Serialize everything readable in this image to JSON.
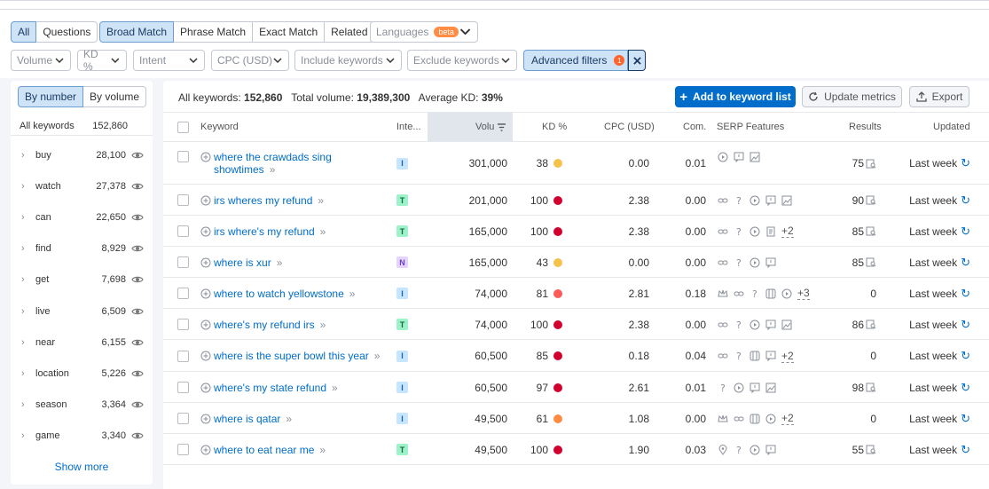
{
  "filters": {
    "tabs": [
      "All",
      "Questions"
    ],
    "match_types": [
      "Broad Match",
      "Phrase Match",
      "Exact Match",
      "Related"
    ],
    "languages": {
      "label": "Languages",
      "badge": "beta"
    },
    "dropdowns": [
      "Volume",
      "KD %",
      "Intent",
      "CPC (USD)",
      "Include keywords",
      "Exclude keywords"
    ],
    "advanced": {
      "label": "Advanced filters",
      "count": "1"
    }
  },
  "sidebar": {
    "toggle": [
      "By number",
      "By volume"
    ],
    "header": {
      "label": "All keywords",
      "count": "152,860"
    },
    "items": [
      {
        "word": "buy",
        "count": "28,100"
      },
      {
        "word": "watch",
        "count": "27,378"
      },
      {
        "word": "can",
        "count": "22,650"
      },
      {
        "word": "find",
        "count": "8,929"
      },
      {
        "word": "get",
        "count": "7,698"
      },
      {
        "word": "live",
        "count": "6,509"
      },
      {
        "word": "near",
        "count": "6,155"
      },
      {
        "word": "location",
        "count": "5,226"
      },
      {
        "word": "season",
        "count": "3,364"
      },
      {
        "word": "game",
        "count": "3,340"
      }
    ],
    "show_more": "Show more"
  },
  "summary": {
    "all_label": "All keywords:",
    "all_value": "152,860",
    "vol_label": "Total volume:",
    "vol_value": "19,389,300",
    "kd_label": "Average KD:",
    "kd_value": "39%"
  },
  "toolbar": {
    "add": "Add to keyword list",
    "update": "Update metrics",
    "export": "Export"
  },
  "columns": {
    "keyword": "Keyword",
    "intent": "Inte...",
    "volume": "Volu",
    "kd": "KD %",
    "cpc": "CPC (USD)",
    "com": "Com.",
    "serp": "SERP Features",
    "results": "Results",
    "updated": "Updated"
  },
  "colors": {
    "easy": "#f5c24a",
    "hard": "#d1002f",
    "mid": "#ff5a5a",
    "medium": "#ff8c42"
  },
  "rows": [
    {
      "kw1": "where the crawdads sing",
      "kw2": "showtimes",
      "intent": "I",
      "volume": "301,000",
      "kd": "38",
      "kd_color": "#f5c24a",
      "cpc": "0.00",
      "com": "0.01",
      "serp": [
        "play",
        "review",
        "image"
      ],
      "more": "",
      "results": "75",
      "updated": "Last week"
    },
    {
      "kw1": "irs wheres my refund",
      "kw2": "",
      "intent": "T",
      "volume": "201,000",
      "kd": "100",
      "kd_color": "#d1002f",
      "cpc": "2.38",
      "com": "0.00",
      "serp": [
        "link",
        "question",
        "play",
        "review",
        "image"
      ],
      "more": "",
      "results": "90",
      "updated": "Last week"
    },
    {
      "kw1": "irs where's my refund",
      "kw2": "",
      "intent": "T",
      "volume": "165,000",
      "kd": "100",
      "kd_color": "#d1002f",
      "cpc": "2.38",
      "com": "0.00",
      "serp": [
        "link",
        "question",
        "play",
        "doc"
      ],
      "more": "+2",
      "results": "85",
      "updated": "Last week"
    },
    {
      "kw1": "where is xur",
      "kw2": "",
      "intent": "N",
      "volume": "165,000",
      "kd": "43",
      "kd_color": "#f5c24a",
      "cpc": "0.00",
      "com": "0.00",
      "serp": [
        "link",
        "question",
        "play",
        "review"
      ],
      "more": "",
      "results": "85",
      "updated": "Last week"
    },
    {
      "kw1": "where to watch yellowstone",
      "kw2": "",
      "intent": "I",
      "volume": "74,000",
      "kd": "81",
      "kd_color": "#ff5a5a",
      "cpc": "2.81",
      "com": "0.18",
      "serp": [
        "crown",
        "link",
        "question",
        "panel",
        "play"
      ],
      "more": "+3",
      "results": "0",
      "updated": "Last week"
    },
    {
      "kw1": "where's my refund irs",
      "kw2": "",
      "intent": "T",
      "volume": "74,000",
      "kd": "100",
      "kd_color": "#d1002f",
      "cpc": "2.38",
      "com": "0.00",
      "serp": [
        "link",
        "question",
        "play",
        "review",
        "image"
      ],
      "more": "",
      "results": "86",
      "updated": "Last week"
    },
    {
      "kw1": "where is the super bowl this year",
      "kw2": "",
      "intent": "I",
      "volume": "60,500",
      "kd": "85",
      "kd_color": "#d1002f",
      "cpc": "0.18",
      "com": "0.04",
      "serp": [
        "link",
        "question",
        "panel",
        "review"
      ],
      "more": "+2",
      "results": "0",
      "updated": "Last week"
    },
    {
      "kw1": "where's my state refund",
      "kw2": "",
      "intent": "I",
      "volume": "60,500",
      "kd": "97",
      "kd_color": "#d1002f",
      "cpc": "2.61",
      "com": "0.01",
      "serp": [
        "question",
        "play",
        "review",
        "image"
      ],
      "more": "",
      "results": "98",
      "updated": "Last week"
    },
    {
      "kw1": "where is qatar",
      "kw2": "",
      "intent": "I",
      "volume": "49,500",
      "kd": "61",
      "kd_color": "#ff8c42",
      "cpc": "1.08",
      "com": "0.00",
      "serp": [
        "crown",
        "link",
        "panel",
        "play"
      ],
      "more": "+2",
      "results": "0",
      "updated": "Last week"
    },
    {
      "kw1": "where to eat near me",
      "kw2": "",
      "intent": "T",
      "volume": "49,500",
      "kd": "100",
      "kd_color": "#d1002f",
      "cpc": "1.90",
      "com": "0.03",
      "serp": [
        "pin",
        "question",
        "play",
        "review"
      ],
      "more": "",
      "results": "55",
      "updated": "Last week"
    }
  ]
}
